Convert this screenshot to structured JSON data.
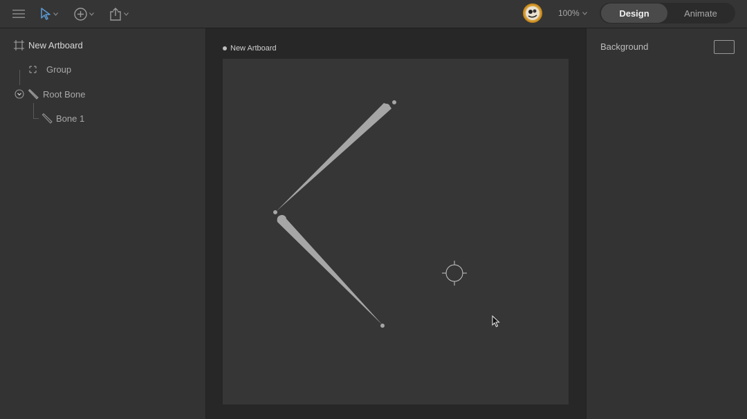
{
  "toolbar": {
    "menu_icon": "hamburger-icon",
    "select_tool_icon": "arrow-pointer-icon",
    "add_tool_icon": "plus-circle-icon",
    "export_icon": "share-icon",
    "zoom_label": "100%",
    "modes": {
      "design": "Design",
      "animate": "Animate"
    }
  },
  "hierarchy": {
    "artboard": "New Artboard",
    "items": [
      {
        "label": "Group"
      },
      {
        "label": "Root Bone"
      },
      {
        "label": "Bone 1"
      }
    ]
  },
  "stage": {
    "artboard_title": "New Artboard"
  },
  "inspector": {
    "background_label": "Background"
  },
  "colors": {
    "accent": "#4a90d9",
    "panel": "#333333",
    "artboard": "#363636",
    "bone": "#a6a6a6"
  }
}
